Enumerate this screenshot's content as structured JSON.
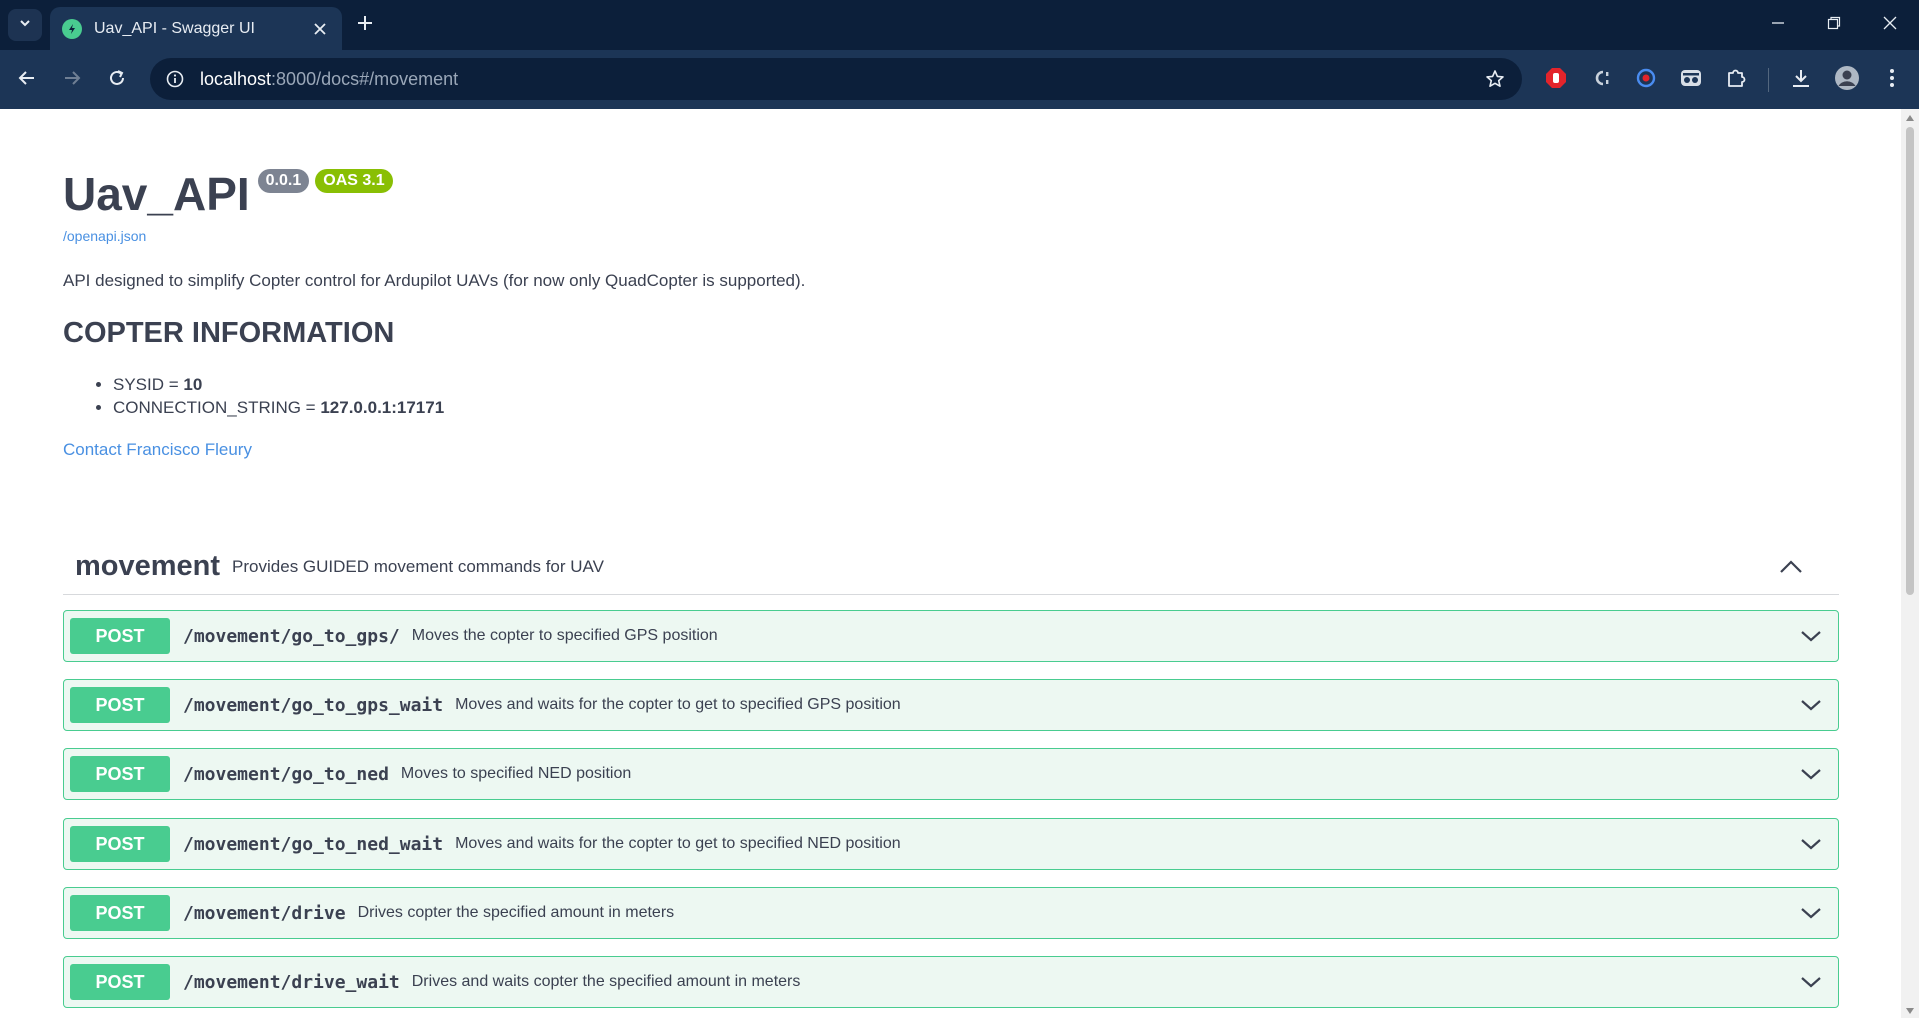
{
  "browser": {
    "tab_title": "Uav_API - Swagger UI",
    "url_host": "localhost",
    "url_rest": ":8000/docs#/movement"
  },
  "icons": {
    "tab_search": "chevron-down-icon",
    "favicon": "swagger-icon",
    "tab_close": "close-icon",
    "new_tab": "plus-icon",
    "minimize": "minimize-icon",
    "restore": "restore-icon",
    "close_window": "close-icon",
    "back": "arrow-left-icon",
    "forward": "arrow-right-icon",
    "reload": "reload-icon",
    "site_info": "info-icon",
    "bookmark": "star-icon",
    "downloads": "download-icon",
    "menu": "kebab-menu-icon"
  },
  "colors": {
    "post_green": "#49cc90",
    "op_background": "#edf8f2",
    "version_badge": "#7d8492",
    "oas_badge": "#89bf04",
    "link": "#4990e2",
    "chrome_dark": "#0c1f3a",
    "chrome_toolbar": "#1c3556"
  },
  "info": {
    "title": "Uav_API",
    "version": "0.0.1",
    "oas": "OAS 3.1",
    "spec_link": "/openapi.json",
    "description": "API designed to simplify Copter control for Ardupilot UAVs (for now only QuadCopter is supported).",
    "section_title": "COPTER INFORMATION",
    "items": [
      {
        "key": "SYSID = ",
        "value": "10"
      },
      {
        "key": "CONNECTION_STRING = ",
        "value": "127.0.0.1:17171"
      }
    ],
    "contact": "Contact Francisco Fleury"
  },
  "tag": {
    "name": "movement",
    "description": "Provides GUIDED movement commands for UAV"
  },
  "operations": [
    {
      "method": "POST",
      "path": "/movement/go_to_gps/",
      "summary": "Moves the copter to specified GPS position"
    },
    {
      "method": "POST",
      "path": "/movement/go_to_gps_wait",
      "summary": "Moves and waits for the copter to get to specified GPS position"
    },
    {
      "method": "POST",
      "path": "/movement/go_to_ned",
      "summary": "Moves to specified NED position"
    },
    {
      "method": "POST",
      "path": "/movement/go_to_ned_wait",
      "summary": "Moves and waits for the copter to get to specified NED position"
    },
    {
      "method": "POST",
      "path": "/movement/drive",
      "summary": "Drives copter the specified amount in meters"
    },
    {
      "method": "POST",
      "path": "/movement/drive_wait",
      "summary": "Drives and waits copter the specified amount in meters"
    }
  ]
}
